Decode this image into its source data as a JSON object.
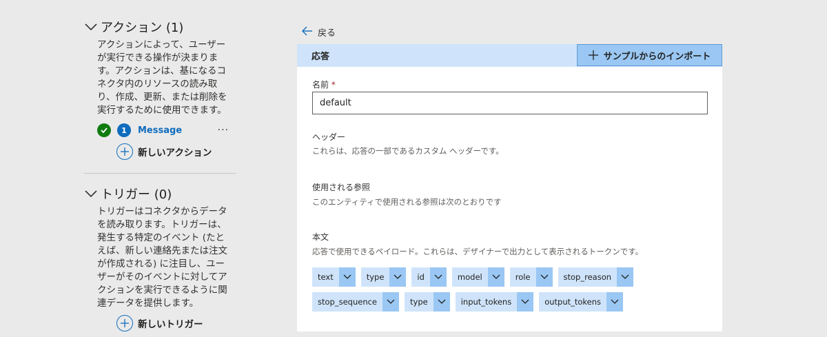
{
  "actions_section": {
    "title": "アクション (1)",
    "description": "アクションによって、ユーザーが実行できる操作が決まります。アクションは、基になるコネクタ内のリソースの読み取り、作成、更新、または削除を実行するために使用できます。",
    "item": {
      "number": "1",
      "name": "Message",
      "more": "···"
    },
    "new_label": "新しいアクション"
  },
  "triggers_section": {
    "title": "トリガー (0)",
    "description": "トリガーはコネクタからデータを読み取ります。トリガーは、発生する特定のイベント (たとえば、新しい連絡先または注文が作成される) に注目し、ユーザーがそのイベントに対してアクションを実行できるように関連データを提供します。",
    "new_label": "新しいトリガー"
  },
  "back_label": "戻る",
  "response": {
    "title": "応答",
    "import_button": "サンプルからのインポート",
    "name_label": "名前",
    "required_mark": "*",
    "name_value": "default",
    "headers_label": "ヘッダー",
    "headers_desc": "これらは、応答の一部であるカスタム ヘッダーです。",
    "refs_label": "使用される参照",
    "refs_desc": "このエンティティで使用される参照は次のとおりです",
    "body_label": "本文",
    "body_desc": "応答で使用できるペイロード。これらは、デザイナーで出力として表示されるトークンです。",
    "tokens_row1": [
      "text",
      "type",
      "id",
      "model",
      "role",
      "stop_reason"
    ],
    "tokens_row2": [
      "stop_sequence",
      "type",
      "input_tokens",
      "output_tokens"
    ]
  }
}
